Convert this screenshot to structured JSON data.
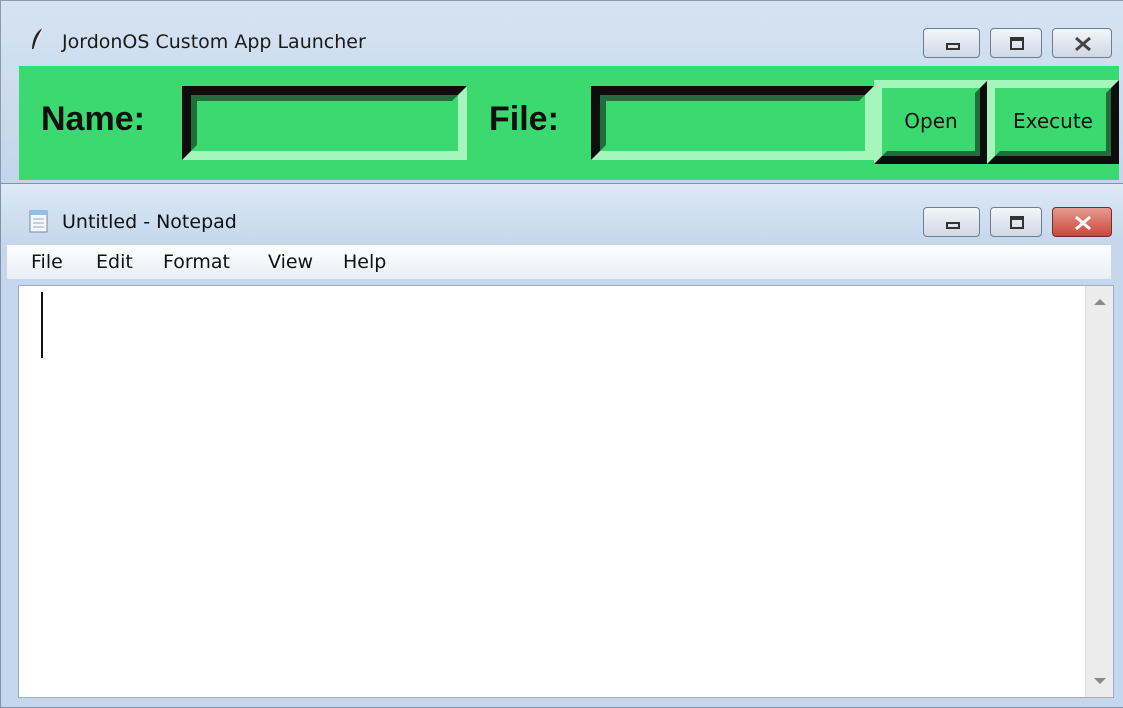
{
  "launcher": {
    "title": "JordonOS Custom App Launcher",
    "icon": "feather-icon",
    "name_label": "Name:",
    "file_label": "File:",
    "name_value": "",
    "file_value": "",
    "open_label": "Open",
    "execute_label": "Execute",
    "accent_color": "#3bd96f"
  },
  "notepad": {
    "title": "Untitled - Notepad",
    "icon": "notepad-icon",
    "menu": [
      "File",
      "Edit",
      "Format",
      "View",
      "Help"
    ],
    "content": ""
  },
  "colors": {
    "close_active": "#c9463d",
    "window_frame": "#c4d7ec"
  }
}
